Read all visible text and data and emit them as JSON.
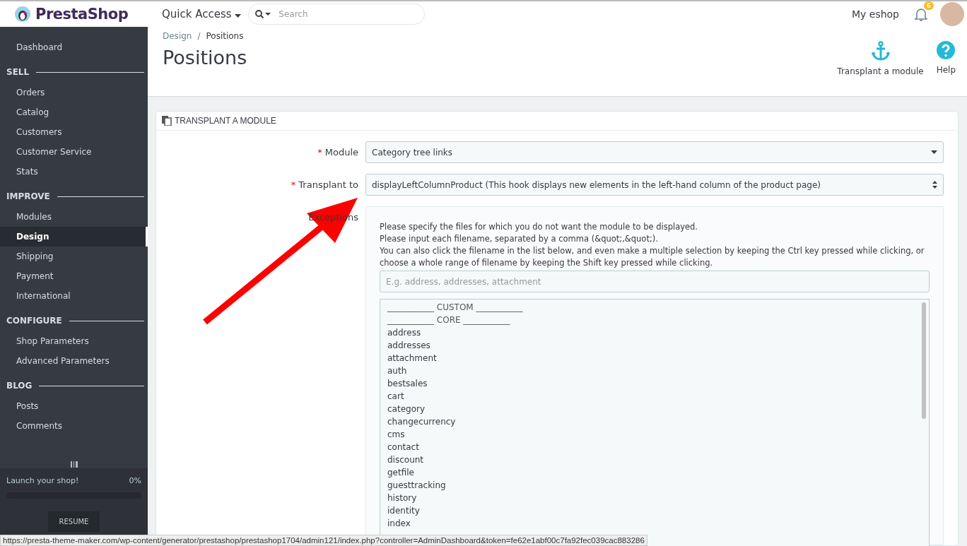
{
  "header": {
    "logo": "PrestaShop",
    "quick_access": "Quick Access",
    "search": {
      "placeholder": "Search"
    },
    "shop": "My eshop",
    "notifications": "6"
  },
  "sidebar": {
    "items": [
      {
        "kind": "link",
        "label": "Dashboard",
        "selected": false
      },
      {
        "kind": "section",
        "label": "SELL"
      },
      {
        "kind": "link",
        "label": "Orders",
        "selected": false
      },
      {
        "kind": "link",
        "label": "Catalog",
        "selected": false
      },
      {
        "kind": "link",
        "label": "Customers",
        "selected": false
      },
      {
        "kind": "link",
        "label": "Customer Service",
        "selected": false
      },
      {
        "kind": "link",
        "label": "Stats",
        "selected": false
      },
      {
        "kind": "section",
        "label": "IMPROVE"
      },
      {
        "kind": "link",
        "label": "Modules",
        "selected": false
      },
      {
        "kind": "link",
        "label": "Design",
        "selected": true
      },
      {
        "kind": "link",
        "label": "Shipping",
        "selected": false
      },
      {
        "kind": "link",
        "label": "Payment",
        "selected": false
      },
      {
        "kind": "link",
        "label": "International",
        "selected": false
      },
      {
        "kind": "section",
        "label": "CONFIGURE"
      },
      {
        "kind": "link",
        "label": "Shop Parameters",
        "selected": false
      },
      {
        "kind": "link",
        "label": "Advanced Parameters",
        "selected": false
      },
      {
        "kind": "section",
        "label": "BLOG"
      },
      {
        "kind": "link",
        "label": "Posts",
        "selected": false
      },
      {
        "kind": "link",
        "label": "Comments",
        "selected": false
      }
    ],
    "launch": {
      "label": "Launch your shop!",
      "percent": "0%",
      "level": 0
    },
    "resume": "RESUME"
  },
  "page": {
    "breadcrumb": [
      "Design",
      "Positions"
    ],
    "breadcrumb_separator": "/",
    "title": "Positions",
    "toolbar": [
      "Transplant a module",
      "Help"
    ]
  },
  "panel": {
    "title": "TRANSPLANT A MODULE",
    "module": {
      "required_mark": "*",
      "label": "Module",
      "value": "Category tree links"
    },
    "transplant_to": {
      "required_mark": "*",
      "label": "Transplant to",
      "value": "displayLeftColumnProduct (This hook displays new elements in the left-hand column of the product page)"
    },
    "exceptions": {
      "label": "Exceptions",
      "help": [
        "Please specify the files for which you do not want the module to be displayed.",
        "Please input each filename, separated by a comma (&quot;,&quot;).",
        "You can also click the filename in the list below, and even make a multiple selection by keeping the Ctrl key pressed while clicking, or choose a whole range of filename by keeping the Shift key pressed while clicking."
      ],
      "placeholder": "E.g. address, addresses, attachment",
      "files": [
        {
          "kind": "group",
          "label": "___________ CUSTOM ___________"
        },
        {
          "kind": "group",
          "label": "___________ CORE ___________"
        },
        {
          "kind": "file",
          "label": "address"
        },
        {
          "kind": "file",
          "label": "addresses"
        },
        {
          "kind": "file",
          "label": "attachment"
        },
        {
          "kind": "file",
          "label": "auth"
        },
        {
          "kind": "file",
          "label": "bestsales"
        },
        {
          "kind": "file",
          "label": "cart"
        },
        {
          "kind": "file",
          "label": "category"
        },
        {
          "kind": "file",
          "label": "changecurrency"
        },
        {
          "kind": "file",
          "label": "cms"
        },
        {
          "kind": "file",
          "label": "contact"
        },
        {
          "kind": "file",
          "label": "discount"
        },
        {
          "kind": "file",
          "label": "getfile"
        },
        {
          "kind": "file",
          "label": "guesttracking"
        },
        {
          "kind": "file",
          "label": "history"
        },
        {
          "kind": "file",
          "label": "identity"
        },
        {
          "kind": "file",
          "label": "index"
        }
      ]
    }
  },
  "status_bar": "https://presta-theme-maker.com/wp-content/generator/prestashop/prestashop1704/admin121/index.php?controller=AdminDashboard&token=fe62e1abf00c7fa92fec039cac883286"
}
